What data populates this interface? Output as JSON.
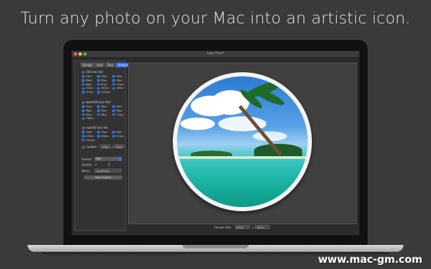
{
  "headline": "Turn any photo on your Mac into an artistic icon.",
  "window_title": "Icon Plus*",
  "tabs": [
    "Design",
    "Icon",
    "Text",
    "Output"
  ],
  "active_tab": "Output",
  "ios_group": "iOS Icon Set",
  "ios_sizes": [
    "20px",
    "29px",
    "40px",
    "58px",
    "60px",
    "76px",
    "80px",
    "87px",
    "120px",
    "152px",
    "167px",
    "180px",
    "512px",
    "1024px"
  ],
  "watch_group": "watchOS Icon Set",
  "watch_sizes": [
    "32px",
    "36px",
    "40px",
    "48px",
    "55px",
    "58px",
    "87px",
    "88px",
    "172px",
    "196px"
  ],
  "mac_group": "macOS Icon Set",
  "mac_sizes": [
    "16px",
    "32px",
    "64px",
    "128px",
    "256px",
    "512px",
    "1024px"
  ],
  "custom": {
    "label": "Custom",
    "width": "1024",
    "x": "x",
    "height": "1024"
  },
  "format": {
    "label": "Format",
    "value": "PNG"
  },
  "quality": {
    "label": "Quality",
    "value": "80"
  },
  "name": {
    "label": "Name",
    "value": "Icon[Size]"
  },
  "save_button": "Save Icon(s)",
  "canvas_size": {
    "label": "Canvas Size:",
    "width": "1024",
    "x": "x",
    "height": "1024"
  },
  "watermark": "www.mac-gm.com",
  "colors": {
    "accent": "#2f6fe0",
    "close": "#ff5f57",
    "minimize": "#febc2e",
    "zoom": "#28c840"
  }
}
